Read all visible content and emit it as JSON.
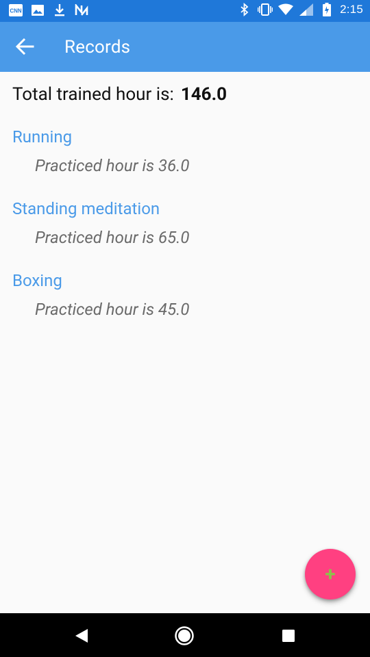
{
  "status_bar": {
    "time": "2:15",
    "left_icons": [
      "cnn-icon",
      "image-icon",
      "download-icon",
      "n-app-icon"
    ],
    "right_icons": [
      "bluetooth-icon",
      "vibrate-icon",
      "wifi-icon",
      "signal-icon",
      "battery-icon"
    ]
  },
  "app_bar": {
    "title": "Records",
    "back_icon": "arrow-left-icon"
  },
  "summary": {
    "label": "Total trained hour is:",
    "value": "146.0"
  },
  "records": [
    {
      "name": "Running",
      "detail": "Practiced hour is 36.0"
    },
    {
      "name": "Standing meditation",
      "detail": "Practiced hour is 65.0"
    },
    {
      "name": "Boxing",
      "detail": "Practiced hour is 45.0"
    }
  ],
  "fab": {
    "label": "+",
    "icon": "plus-icon"
  },
  "colors": {
    "status_bar": "#1f78d9",
    "app_bar": "#4a9ae8",
    "accent": "#ff4081",
    "record_name": "#4a9ae8"
  }
}
